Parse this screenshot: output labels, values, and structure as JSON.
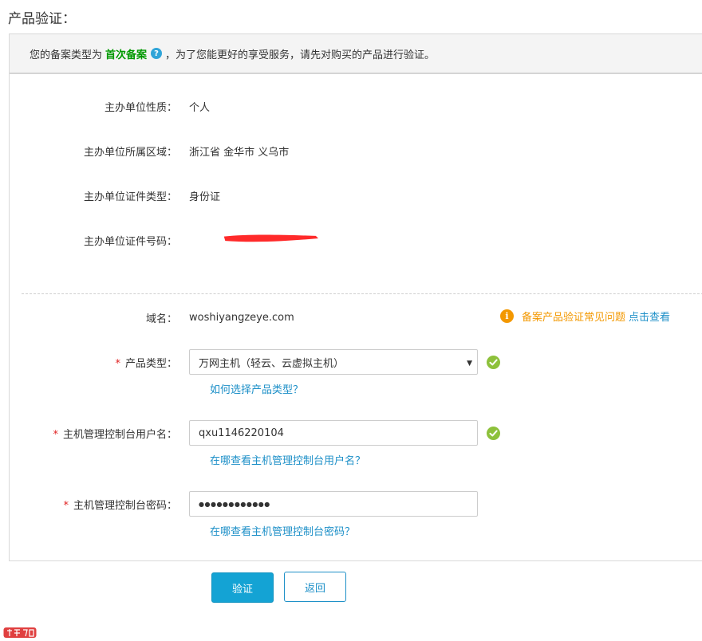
{
  "page_title": "产品验证：",
  "notice": {
    "prefix": "您的备案类型为",
    "type": "首次备案",
    "suffix": "，为了您能更好的享受服务，请先对购买的产品进行验证。"
  },
  "info": {
    "nature_label": "主办单位性质：",
    "nature_value": "个人",
    "region_label": "主办单位所属区域：",
    "region_value": "浙江省 金华市 义乌市",
    "cert_type_label": "主办单位证件类型：",
    "cert_type_value": "身份证",
    "cert_no_label": "主办单位证件号码："
  },
  "form": {
    "required_mark": "*",
    "domain_label": "域名：",
    "domain_value": "woshiyangzeye.com",
    "faq_text": "备案产品验证常见问题",
    "faq_link": "点击查看",
    "product_type_label": "产品类型：",
    "product_type_value": "万网主机（轻云、云虚拟主机）",
    "product_type_help": "如何选择产品类型？",
    "username_label": "主机管理控制台用户名：",
    "username_value": "qxu1146220104",
    "username_help": "在哪查看主机管理控制台用户名？",
    "password_label": "主机管理控制台密码：",
    "password_value": "●●●●●●●●●●●●",
    "password_help": "在哪查看主机管理控制台密码？"
  },
  "buttons": {
    "verify": "验证",
    "back": "返回"
  },
  "colors": {
    "accent": "#14a3d4",
    "link": "#1e90c8",
    "success": "#8dc13b",
    "warning": "#f39800",
    "highlight": "#009900",
    "required": "#e02020"
  }
}
